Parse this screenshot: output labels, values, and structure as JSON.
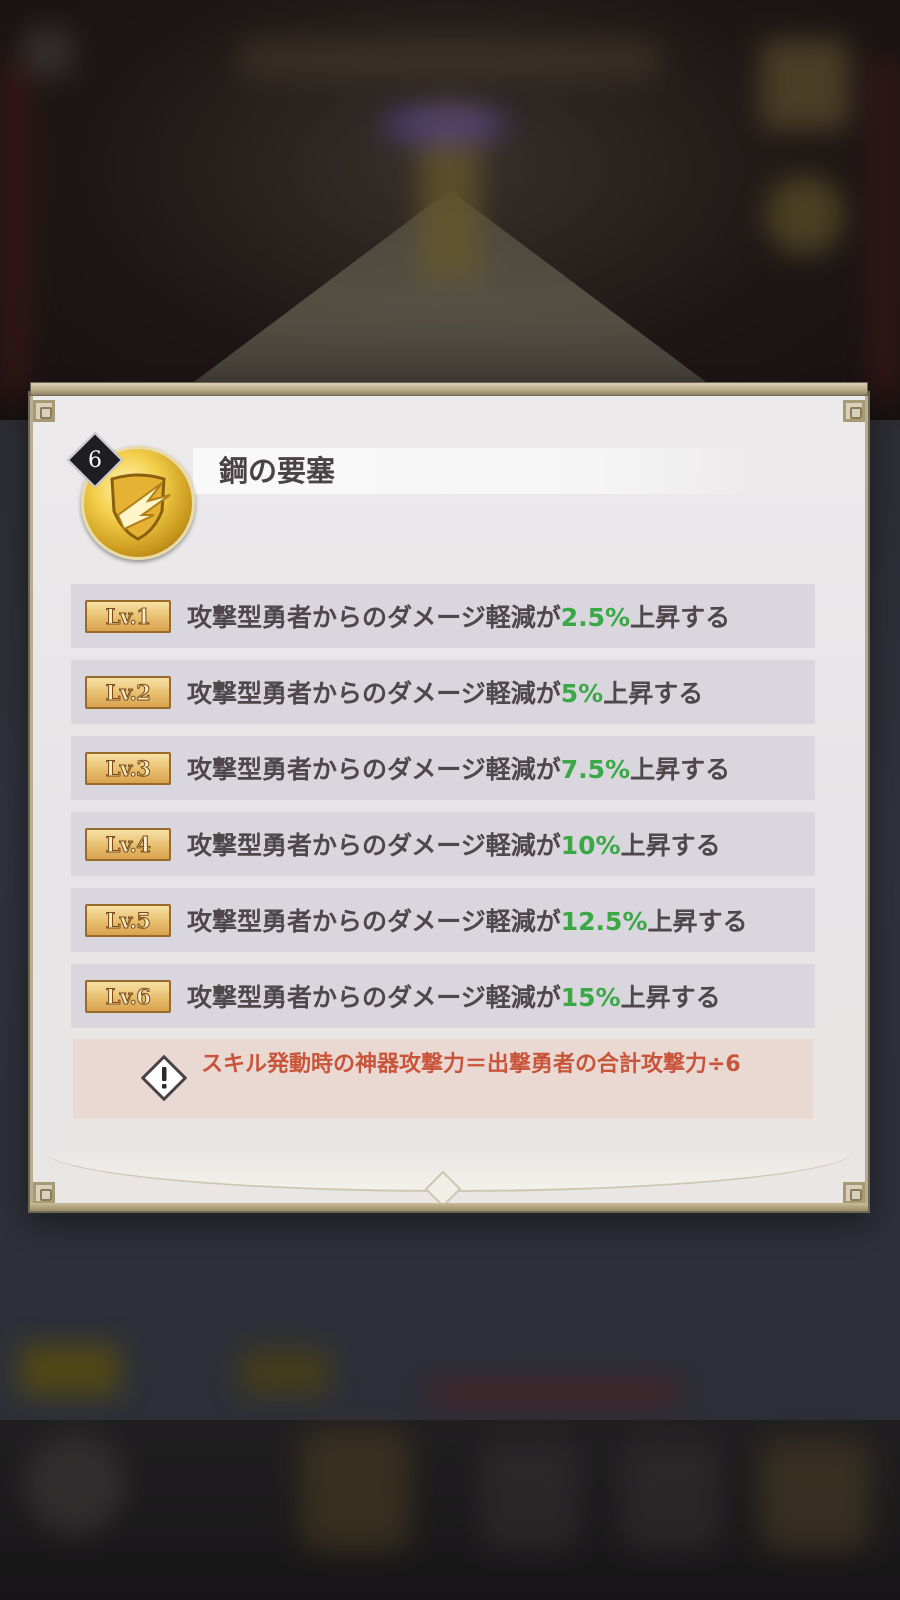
{
  "skill": {
    "level": "6",
    "title": "鋼の要塞",
    "icon": "golden-shield-emblem"
  },
  "levels": [
    {
      "badge": "Lv.1",
      "prefix": "攻撃型勇者からのダメージ軽減が",
      "value": "2.5%",
      "suffix": "上昇する"
    },
    {
      "badge": "Lv.2",
      "prefix": "攻撃型勇者からのダメージ軽減が",
      "value": "5%",
      "suffix": "上昇する"
    },
    {
      "badge": "Lv.3",
      "prefix": "攻撃型勇者からのダメージ軽減が",
      "value": "7.5%",
      "suffix": "上昇する"
    },
    {
      "badge": "Lv.4",
      "prefix": "攻撃型勇者からのダメージ軽減が",
      "value": "10%",
      "suffix": "上昇する"
    },
    {
      "badge": "Lv.5",
      "prefix": "攻撃型勇者からのダメージ軽減が",
      "value": "12.5%",
      "suffix": "上昇する"
    },
    {
      "badge": "Lv.6",
      "prefix": "攻撃型勇者からのダメージ軽減が",
      "value": "15%",
      "suffix": "上昇する"
    }
  ],
  "note": {
    "icon": "warning-icon",
    "text": "スキル発動時の神器攻撃力＝出撃勇者の合計攻撃力÷6"
  },
  "colors": {
    "value_green": "#3aa845",
    "note_red": "#c8553a",
    "title_text": "#4a4346"
  }
}
